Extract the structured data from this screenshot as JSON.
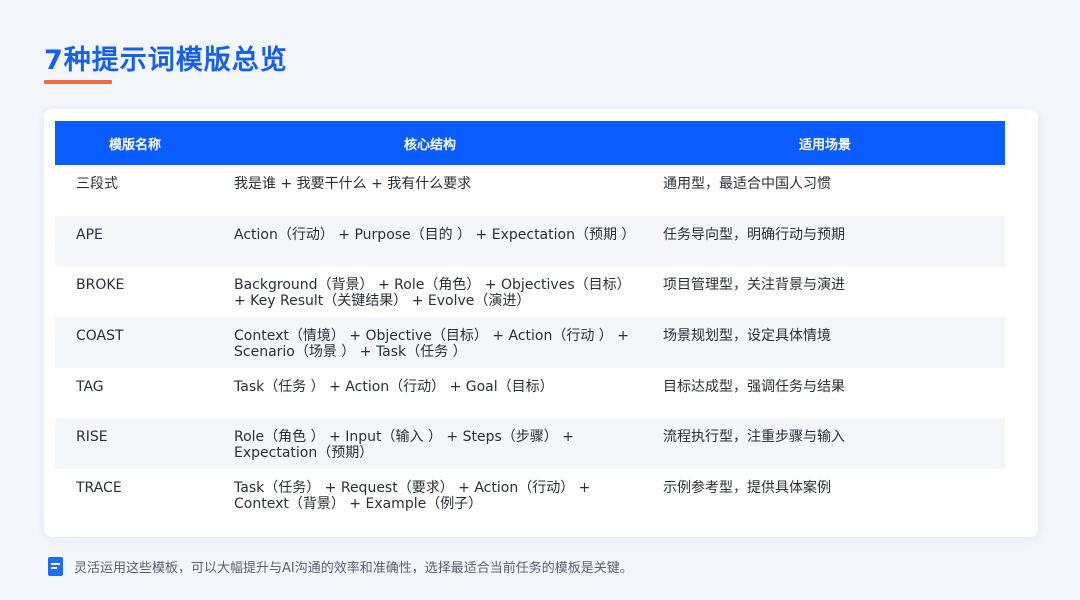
{
  "page": {
    "title": "7种提示词模版总览"
  },
  "table": {
    "headers": {
      "name": "模版名称",
      "structure": "核心结构",
      "scenario": "适用场景"
    },
    "rows": [
      {
        "name": "三段式",
        "structure": "我是谁 + 我要干什么 + 我有什么要求",
        "scenario": "通用型，最适合中国人习惯"
      },
      {
        "name": "APE",
        "structure": "Action（行动） + Purpose（目的 ） + Expectation（预期 ）",
        "scenario": "任务导向型，明确行动与预期"
      },
      {
        "name": "BROKE",
        "structure": "Background（背景） + Role（角色） + Objectives（目标） + Key Result（关键结果） + Evolve（演进）",
        "scenario": "项目管理型，关注背景与演进"
      },
      {
        "name": "COAST",
        "structure": "Context（情境） + Objective（目标） + Action（行动 ） + Scenario（场景 ） + Task（任务 ）",
        "scenario": "场景规划型，设定具体情境"
      },
      {
        "name": "TAG",
        "structure": "Task（任务 ） + Action（行动） + Goal（目标）",
        "scenario": "目标达成型，强调任务与结果"
      },
      {
        "name": "RISE",
        "structure": "Role（角色 ） + Input（输入 ） + Steps（步骤） + Expectation（预期）",
        "scenario": "流程执行型，注重步骤与输入"
      },
      {
        "name": "TRACE",
        "structure": "Task（任务） + Request（要求） + Action（行动） + Context（背景） + Example（例子）",
        "scenario": "示例参考型，提供具体案例"
      }
    ]
  },
  "footer": {
    "icon": "document-note-icon",
    "note": "灵活运用这些模板，可以大幅提升与AI沟通的效率和准确性，选择最适合当前任务的模板是关键。"
  },
  "colors": {
    "accent_blue": "#0b5cff",
    "title_blue": "#1560f0",
    "underline_orange": "#f26a3d"
  }
}
